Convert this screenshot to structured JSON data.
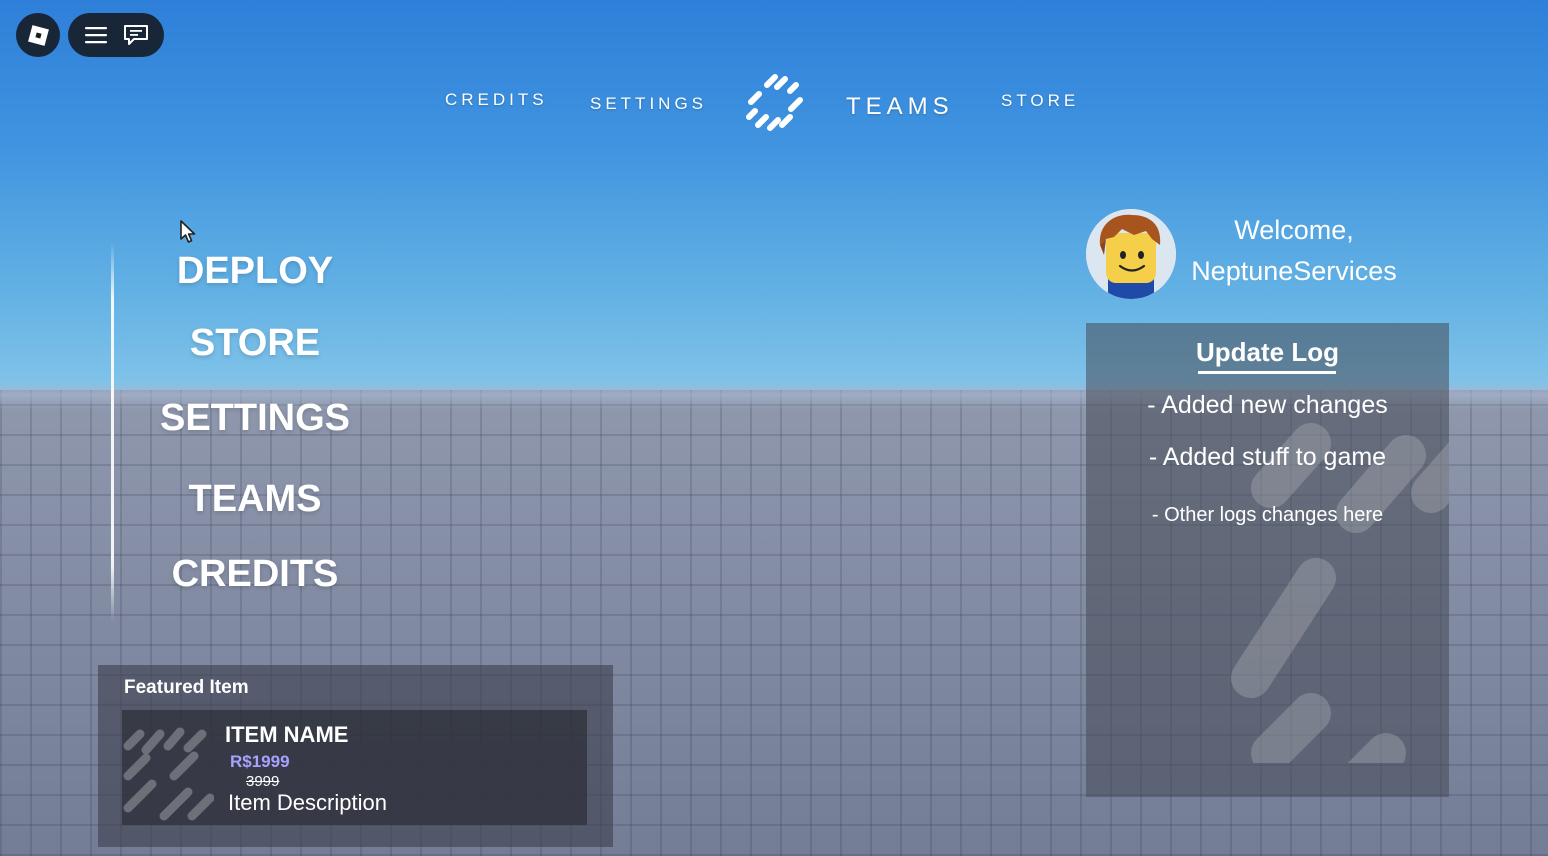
{
  "topnav": {
    "credits": "CREDITS",
    "settings": "SETTINGS",
    "teams": "TEAMS",
    "store": "STORE"
  },
  "side_menu": {
    "items": [
      {
        "label": "DEPLOY"
      },
      {
        "label": "STORE"
      },
      {
        "label": "SETTINGS"
      },
      {
        "label": "TEAMS"
      },
      {
        "label": "CREDITS"
      }
    ]
  },
  "welcome": {
    "line1": "Welcome,",
    "username": "NeptuneServices"
  },
  "update_log": {
    "title": "Update Log",
    "entries": [
      "- Added new changes",
      "- Added stuff to game",
      "- Other logs changes here"
    ]
  },
  "featured": {
    "title": "Featured Item",
    "item_name": "ITEM NAME",
    "price": "R$1999",
    "old_price": "3999",
    "description": "Item Description"
  },
  "colors": {
    "price_accent": "#a6a2ff",
    "panel_bg": "#464a56"
  },
  "icons": {
    "roblox": "roblox-logo-icon",
    "menu": "hamburger-menu-icon",
    "chat": "chat-bubble-icon",
    "brand": "striped-diamond-logo-icon",
    "cursor": "mouse-cursor-icon"
  }
}
